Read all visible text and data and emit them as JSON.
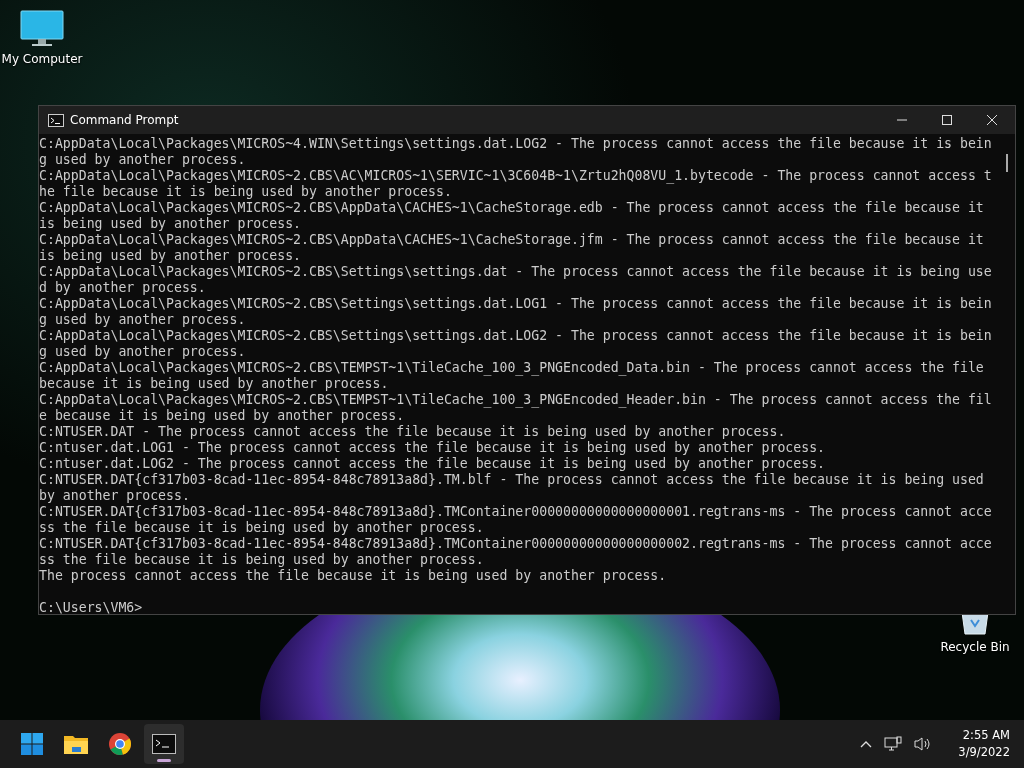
{
  "desktop_icons": [
    {
      "kind": "computer",
      "label": "My Computer"
    },
    {
      "kind": "recycle",
      "label": "Recycle Bin"
    }
  ],
  "window": {
    "title": "Command Prompt",
    "lines": [
      "C:AppData\\Local\\Packages\\MICROS~4.WIN\\Settings\\settings.dat.LOG2 - The process cannot access the file because it is bein",
      "g used by another process.",
      "C:AppData\\Local\\Packages\\MICROS~2.CBS\\AC\\MICROS~1\\SERVIC~1\\3C604B~1\\Zrtu2hQ08VU_1.bytecode - The process cannot access t",
      "he file because it is being used by another process.",
      "C:AppData\\Local\\Packages\\MICROS~2.CBS\\AppData\\CACHES~1\\CacheStorage.edb - The process cannot access the file because it",
      "is being used by another process.",
      "C:AppData\\Local\\Packages\\MICROS~2.CBS\\AppData\\CACHES~1\\CacheStorage.jfm - The process cannot access the file because it",
      "is being used by another process.",
      "C:AppData\\Local\\Packages\\MICROS~2.CBS\\Settings\\settings.dat - The process cannot access the file because it is being use",
      "d by another process.",
      "C:AppData\\Local\\Packages\\MICROS~2.CBS\\Settings\\settings.dat.LOG1 - The process cannot access the file because it is bein",
      "g used by another process.",
      "C:AppData\\Local\\Packages\\MICROS~2.CBS\\Settings\\settings.dat.LOG2 - The process cannot access the file because it is bein",
      "g used by another process.",
      "C:AppData\\Local\\Packages\\MICROS~2.CBS\\TEMPST~1\\TileCache_100_3_PNGEncoded_Data.bin - The process cannot access the file",
      "because it is being used by another process.",
      "C:AppData\\Local\\Packages\\MICROS~2.CBS\\TEMPST~1\\TileCache_100_3_PNGEncoded_Header.bin - The process cannot access the fil",
      "e because it is being used by another process.",
      "C:NTUSER.DAT - The process cannot access the file because it is being used by another process.",
      "C:ntuser.dat.LOG1 - The process cannot access the file because it is being used by another process.",
      "C:ntuser.dat.LOG2 - The process cannot access the file because it is being used by another process.",
      "C:NTUSER.DAT{cf317b03-8cad-11ec-8954-848c78913a8d}.TM.blf - The process cannot access the file because it is being used",
      "by another process.",
      "C:NTUSER.DAT{cf317b03-8cad-11ec-8954-848c78913a8d}.TMContainer00000000000000000001.regtrans-ms - The process cannot acce",
      "ss the file because it is being used by another process.",
      "C:NTUSER.DAT{cf317b03-8cad-11ec-8954-848c78913a8d}.TMContainer00000000000000000002.regtrans-ms - The process cannot acce",
      "ss the file because it is being used by another process.",
      "The process cannot access the file because it is being used by another process."
    ],
    "prompt": "C:\\Users\\VM6>"
  },
  "taskbar": {
    "apps": [
      {
        "kind": "start",
        "selected": false
      },
      {
        "kind": "folder",
        "selected": false
      },
      {
        "kind": "browser",
        "selected": false
      },
      {
        "kind": "terminal",
        "selected": true
      }
    ],
    "clock": {
      "time": "2:55 AM",
      "date": "3/9/2022"
    }
  }
}
